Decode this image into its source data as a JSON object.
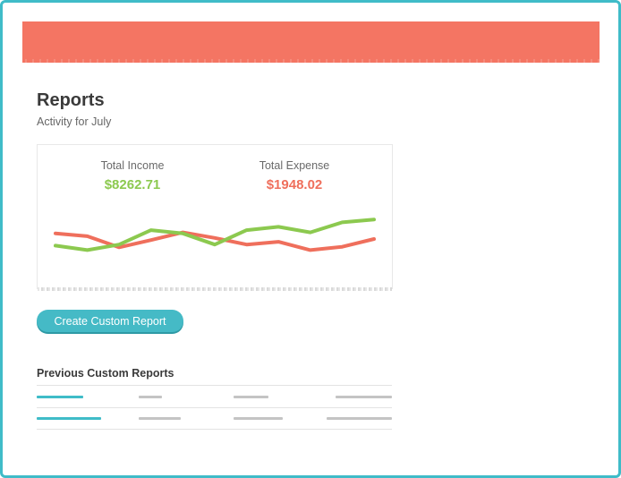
{
  "colors": {
    "frame": "#3fbcc8",
    "header": "#f47563",
    "income": "#8cc94f",
    "expense": "#ef6f5c",
    "button": "#45bac6",
    "placeholder": "#c4c4c4"
  },
  "page": {
    "title": "Reports",
    "subtitle": "Activity for July"
  },
  "summary": {
    "income_label": "Total Income",
    "income_value": "$8262.71",
    "expense_label": "Total Expense",
    "expense_value": "$1948.02"
  },
  "chart_data": {
    "type": "line",
    "xlabel": "",
    "ylabel": "",
    "ylim": [
      0,
      100
    ],
    "grid": false,
    "series": [
      {
        "color": "#ef6f5c",
        "values": [
          60,
          55,
          35,
          48,
          62,
          52,
          40,
          45,
          30,
          36,
          50
        ]
      },
      {
        "color": "#8cc94f",
        "values": [
          38,
          30,
          40,
          66,
          60,
          40,
          66,
          72,
          62,
          80,
          85
        ]
      }
    ]
  },
  "actions": {
    "create_report_label": "Create Custom Report"
  },
  "previous_reports": {
    "heading": "Previous Custom Reports"
  }
}
